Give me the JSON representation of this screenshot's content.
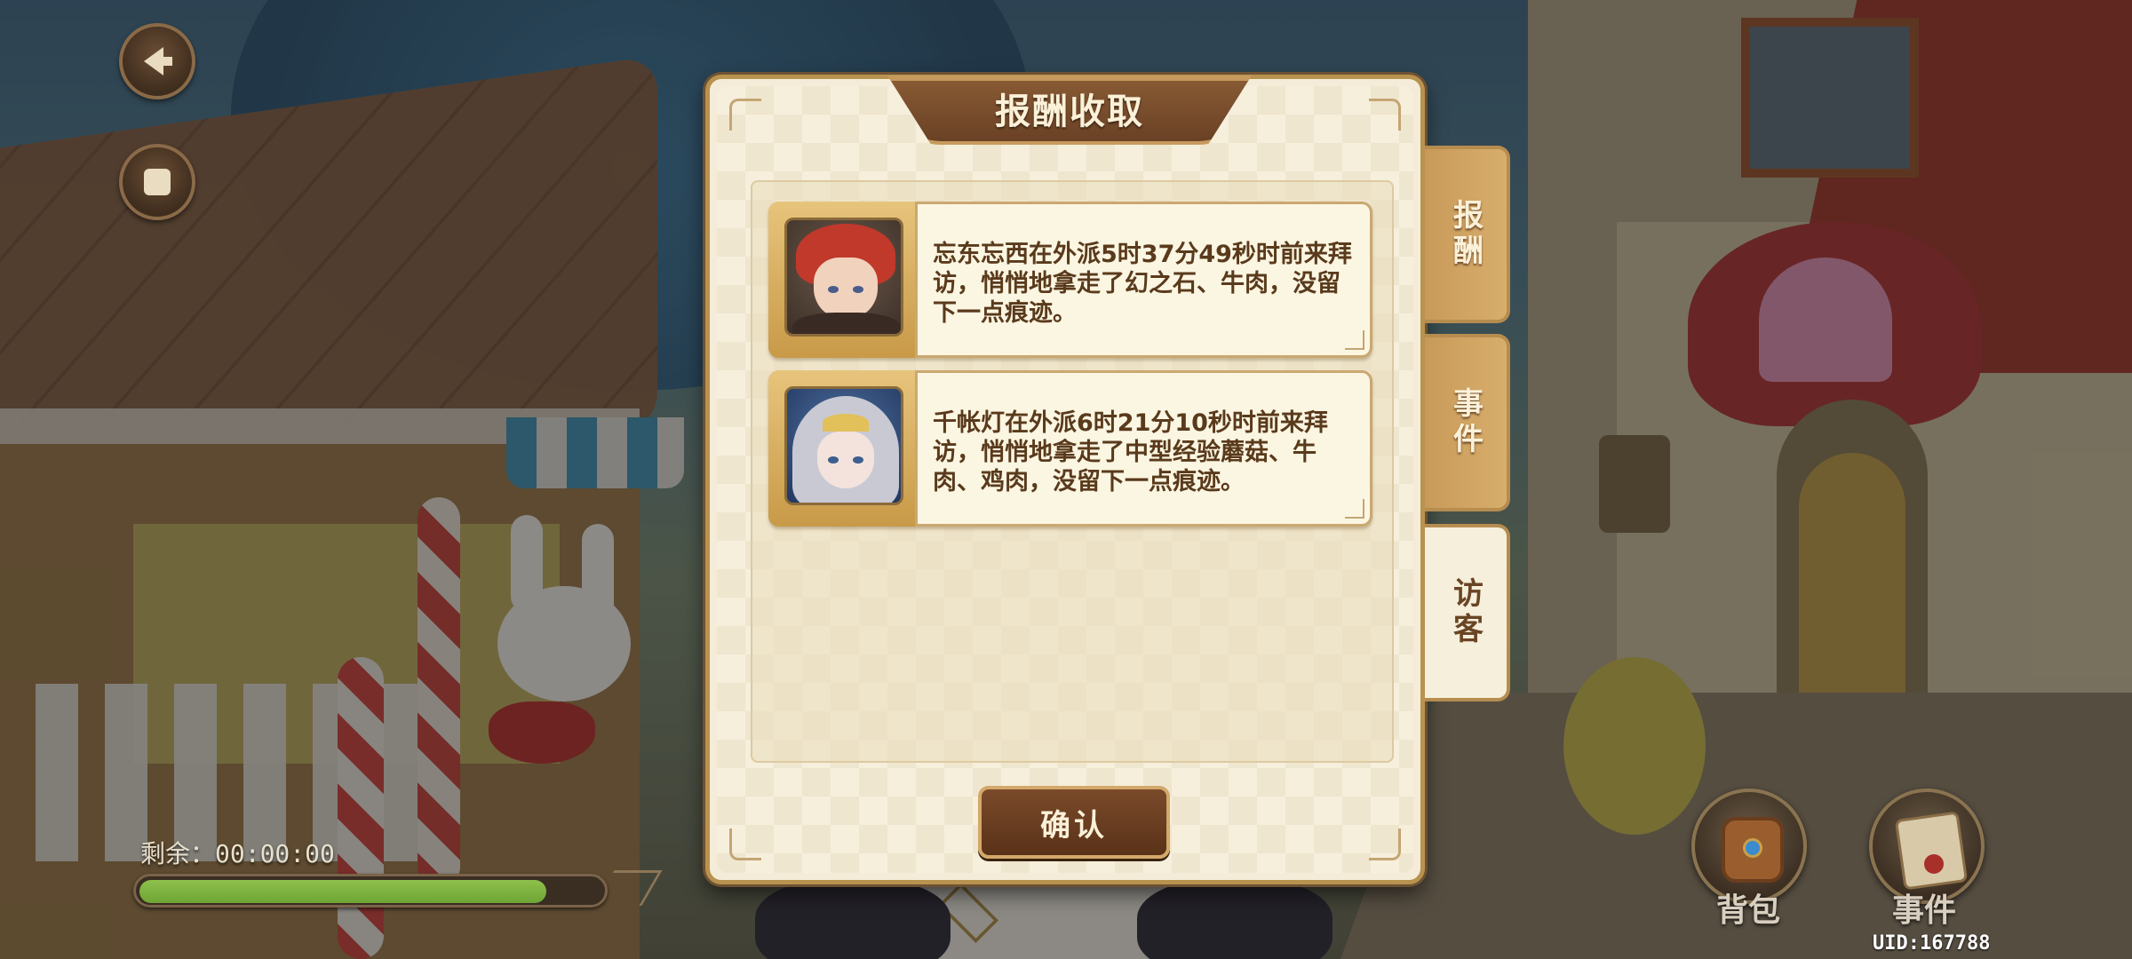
{
  "dialog": {
    "title": "报酬收取",
    "confirm_label": "确认",
    "tabs": [
      {
        "label": "报酬",
        "active": false
      },
      {
        "label": "事件",
        "active": false
      },
      {
        "label": "访客",
        "active": true
      }
    ],
    "visits": [
      {
        "portrait": "red-haired-hero-portrait",
        "text": "忘东忘西在外派5时37分49秒时前来拜访，悄悄地拿走了幻之石、牛肉，没留下一点痕迹。"
      },
      {
        "portrait": "silver-haired-girl-portrait",
        "text": "千帐灯在外派6时21分10秒时前来拜访，悄悄地拿走了中型经验蘑菇、牛肉、鸡肉，没留下一点痕迹。"
      }
    ]
  },
  "hud": {
    "timer_text": "剩余：00:00:00",
    "timer_progress": 0.88,
    "bag_label": "背包",
    "event_label": "事件",
    "uid_text": "UID:167788"
  },
  "colors": {
    "accent_brown": "#6a4125",
    "panel_cream": "#f6efdc",
    "text_brown": "#5a3a1c",
    "progress_green": "#6fa535"
  }
}
